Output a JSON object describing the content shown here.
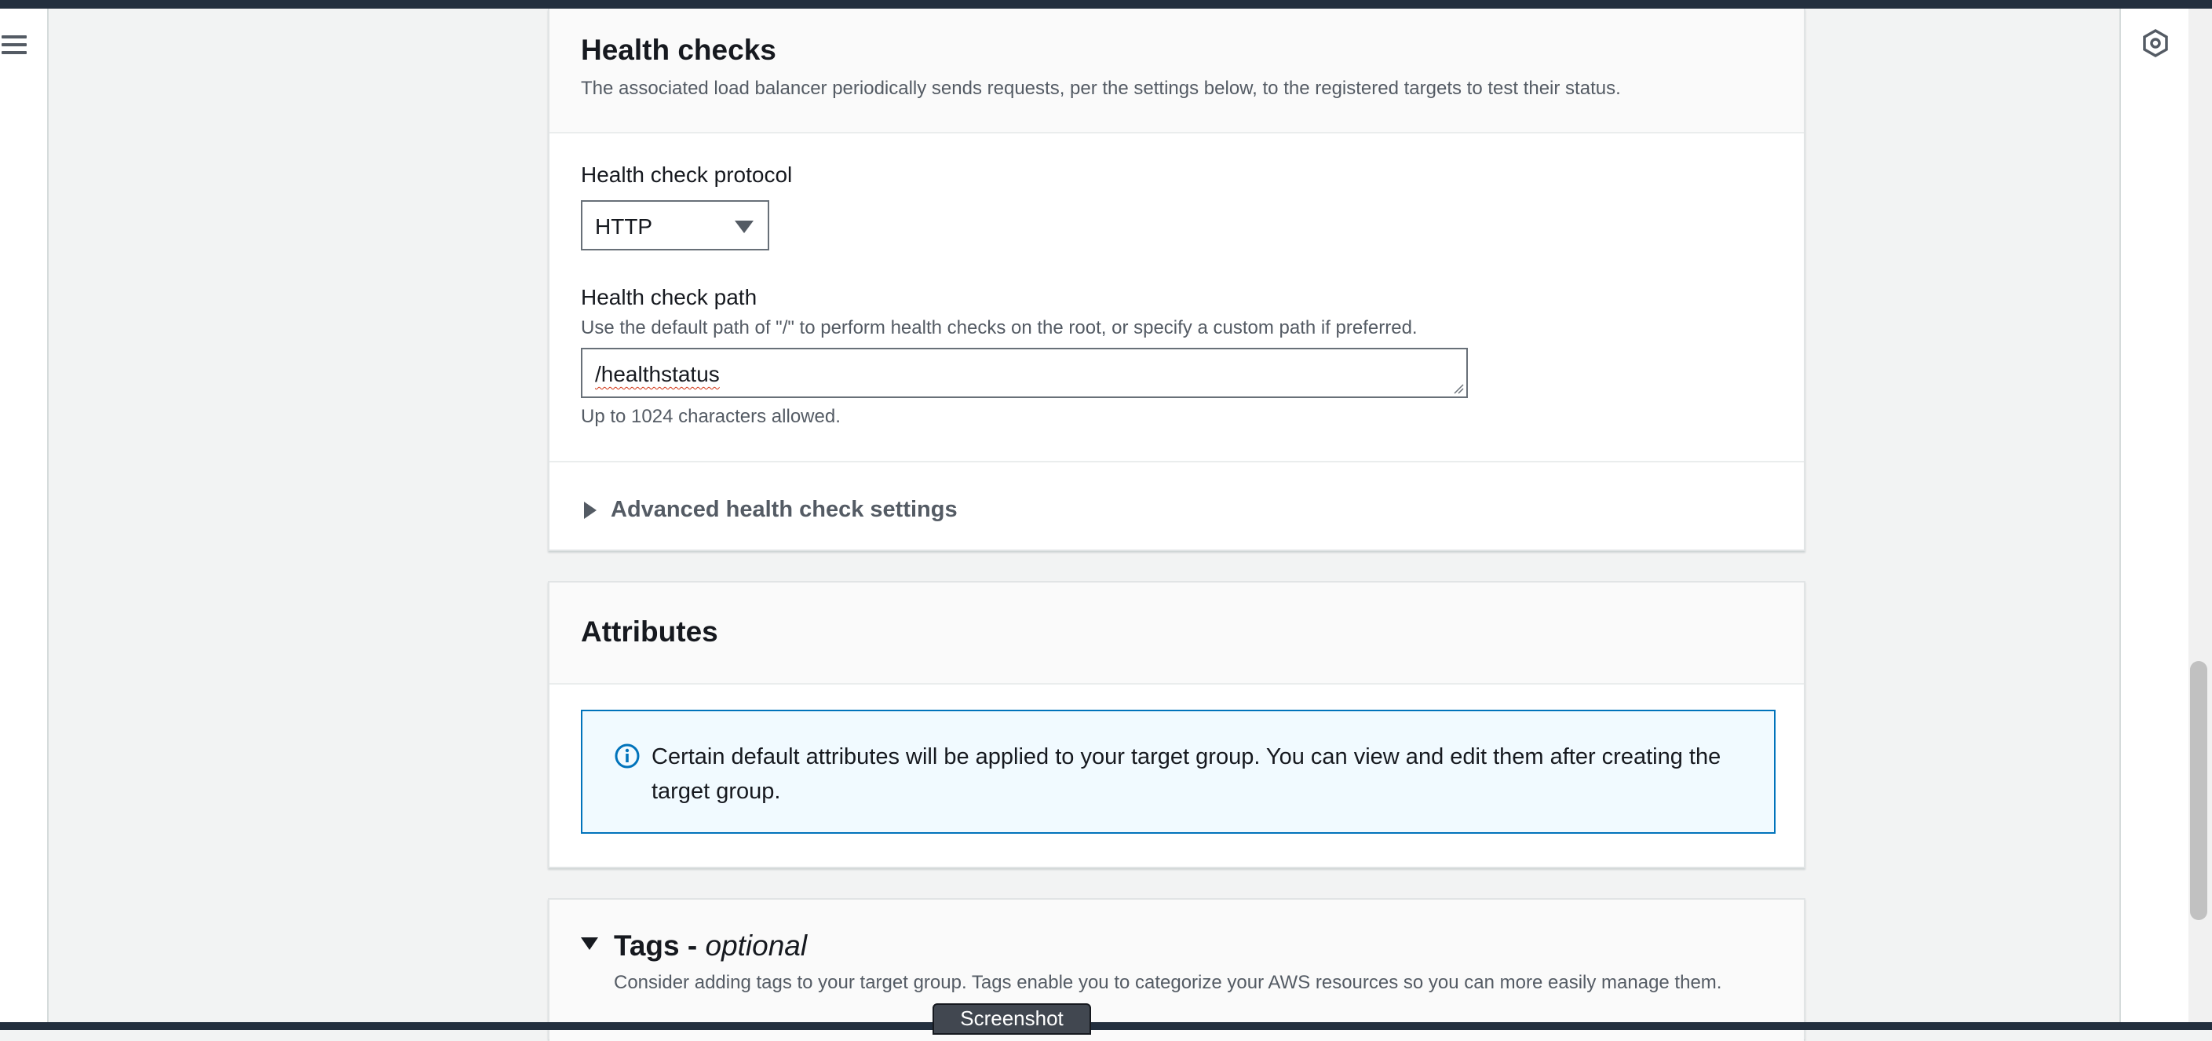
{
  "health_checks": {
    "title": "Health checks",
    "description": "The associated load balancer periodically sends requests, per the settings below, to the registered targets to test their status.",
    "protocol": {
      "label": "Health check protocol",
      "value": "HTTP"
    },
    "path": {
      "label": "Health check path",
      "description": "Use the default path of \"/\" to perform health checks on the root, or specify a custom path if preferred.",
      "value": "/healthstatus",
      "constraint": "Up to 1024 characters allowed."
    },
    "advanced_label": "Advanced health check settings"
  },
  "attributes": {
    "title": "Attributes",
    "info": "Certain default attributes will be applied to your target group. You can view and edit them after creating the target group."
  },
  "tags": {
    "title": "Tags -",
    "title_suffix": "optional",
    "description": "Consider adding tags to your target group. Tags enable you to categorize your AWS resources so you can more easily manage them."
  },
  "tooltip": "Screenshot",
  "icons": {
    "menu": "hamburger-menu-icon",
    "rail": "hexagon-icon",
    "info": "info-icon"
  },
  "colors": {
    "top_bar": "#232f3e",
    "info_border": "#0073bb",
    "info_background": "#f1faff"
  }
}
